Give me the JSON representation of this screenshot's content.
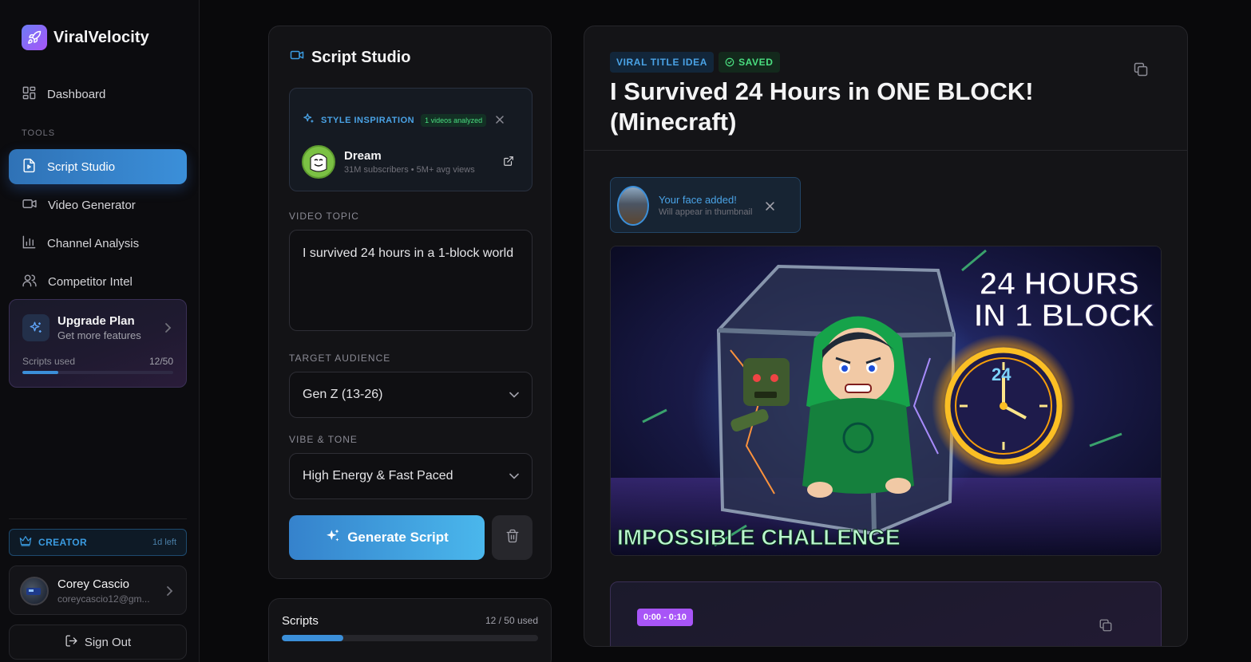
{
  "app": {
    "name": "ViralVelocity"
  },
  "sidebar": {
    "dashboard_label": "Dashboard",
    "tools_section": "TOOLS",
    "items": [
      {
        "label": "Script Studio",
        "icon": "file-play-icon",
        "active": true
      },
      {
        "label": "Video Generator",
        "icon": "video-camera-icon",
        "active": false
      },
      {
        "label": "Channel Analysis",
        "icon": "bar-chart-icon",
        "active": false
      },
      {
        "label": "Competitor Intel",
        "icon": "users-icon",
        "active": false
      }
    ],
    "upgrade": {
      "title": "Upgrade Plan",
      "subtitle": "Get more features",
      "usage_label": "Scripts used",
      "usage_value": "12/50",
      "usage_fraction": 0.24
    },
    "plan": {
      "label": "CREATOR",
      "time_left": "1d left"
    },
    "user": {
      "name": "Corey Cascio",
      "email": "coreycascio12@gm..."
    },
    "sign_out_label": "Sign Out"
  },
  "studio": {
    "title": "Script Studio",
    "inspiration": {
      "label": "STYLE INSPIRATION",
      "count": "1 videos analyzed",
      "channel_name": "Dream",
      "channel_stats": "31M subscribers • 5M+ avg views"
    },
    "topic": {
      "label": "VIDEO TOPIC",
      "value": "I survived 24 hours in a 1-block world"
    },
    "audience": {
      "label": "TARGET AUDIENCE",
      "value": "Gen Z (13-26)"
    },
    "tone": {
      "label": "VIBE & TONE",
      "value": "High Energy & Fast Paced"
    },
    "generate_label": "Generate Script"
  },
  "scripts_usage": {
    "title": "Scripts",
    "used_label": "12 / 50 used",
    "fraction": 0.24
  },
  "output": {
    "badge_viral": "VIRAL TITLE IDEA",
    "badge_saved": "SAVED",
    "title": "I Survived 24 Hours in ONE BLOCK! (Minecraft)",
    "face": {
      "title": "Your face added!",
      "subtitle": "Will appear in thumbnail"
    },
    "thumbnail": {
      "headline_line1": "24 HOURS",
      "headline_line2": "IN 1 BLOCK",
      "banner": "IMPOSSIBLE CHALLENGE",
      "clock_number": "24"
    },
    "scene": {
      "time_range": "0:00 - 0:10"
    }
  },
  "colors": {
    "accent": "#3b8fd9",
    "success": "#4ade80",
    "purple": "#a855f7",
    "background": "#09090b"
  }
}
